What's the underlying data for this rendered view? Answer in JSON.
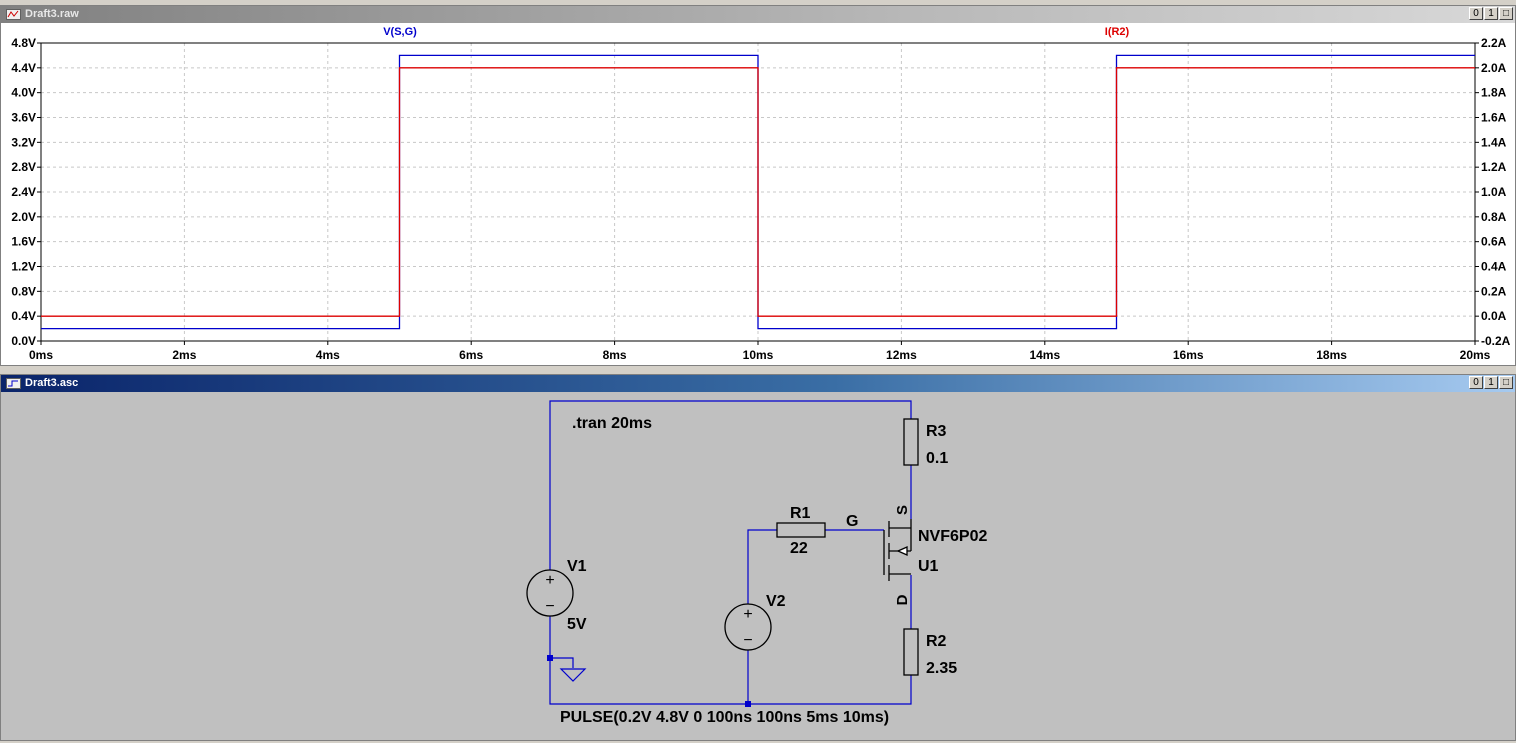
{
  "plot_window": {
    "title": "Draft3.raw",
    "buttons": [
      "0",
      "1",
      "□"
    ]
  },
  "schematic_window": {
    "title": "Draft3.asc",
    "buttons": [
      "0",
      "1",
      "□"
    ]
  },
  "colors": {
    "trace_v": "#0000cc",
    "trace_i": "#dd0000",
    "grid": "#c8c8c8",
    "wire": "#0000cc",
    "schematic_bg": "#c0c0c0"
  },
  "chart_data": {
    "type": "line",
    "x_unit": "ms",
    "xlim": [
      0,
      20
    ],
    "x_ticks": [
      "0ms",
      "2ms",
      "4ms",
      "6ms",
      "8ms",
      "10ms",
      "12ms",
      "14ms",
      "16ms",
      "18ms",
      "20ms"
    ],
    "left_axis": {
      "ylim": [
        0,
        4.8
      ],
      "ticks": [
        "0.0V",
        "0.4V",
        "0.8V",
        "1.2V",
        "1.6V",
        "2.0V",
        "2.4V",
        "2.8V",
        "3.2V",
        "3.6V",
        "4.0V",
        "4.4V",
        "4.8V"
      ]
    },
    "right_axis": {
      "ylim": [
        -0.2,
        2.2
      ],
      "ticks": [
        "-0.2A",
        "0.0A",
        "0.2A",
        "0.4A",
        "0.6A",
        "0.8A",
        "1.0A",
        "1.2A",
        "1.4A",
        "1.6A",
        "1.8A",
        "2.0A",
        "2.2A"
      ]
    },
    "grid": true,
    "series": [
      {
        "name": "V(S,G)",
        "axis": "left",
        "color": "#0000cc",
        "x": [
          0,
          5,
          5,
          10,
          10,
          15,
          15,
          20
        ],
        "y": [
          0.2,
          0.2,
          4.6,
          4.6,
          0.2,
          0.2,
          4.6,
          4.6
        ]
      },
      {
        "name": "I(R2)",
        "axis": "right",
        "color": "#dd0000",
        "x": [
          0,
          5,
          5,
          10,
          10,
          15,
          15,
          20
        ],
        "y": [
          0.0,
          0.0,
          2.0,
          2.0,
          0.0,
          0.0,
          2.0,
          2.0
        ]
      }
    ]
  },
  "schematic": {
    "directive": ".tran 20ms",
    "r3": {
      "name": "R3",
      "value": "0.1"
    },
    "r1": {
      "name": "R1",
      "value": "22"
    },
    "r2": {
      "name": "R2",
      "value": "2.35"
    },
    "v1": {
      "name": "V1",
      "value": "5V"
    },
    "v2": {
      "name": "V2",
      "value": "PULSE(0.2V 4.8V 0 100ns 100ns 5ms 10ms)"
    },
    "u1": {
      "name": "U1",
      "model": "NVF6P02"
    },
    "net_g": "G",
    "pin_s": "S",
    "pin_d": "D",
    "source_plus": "+",
    "source_minus": "−"
  }
}
